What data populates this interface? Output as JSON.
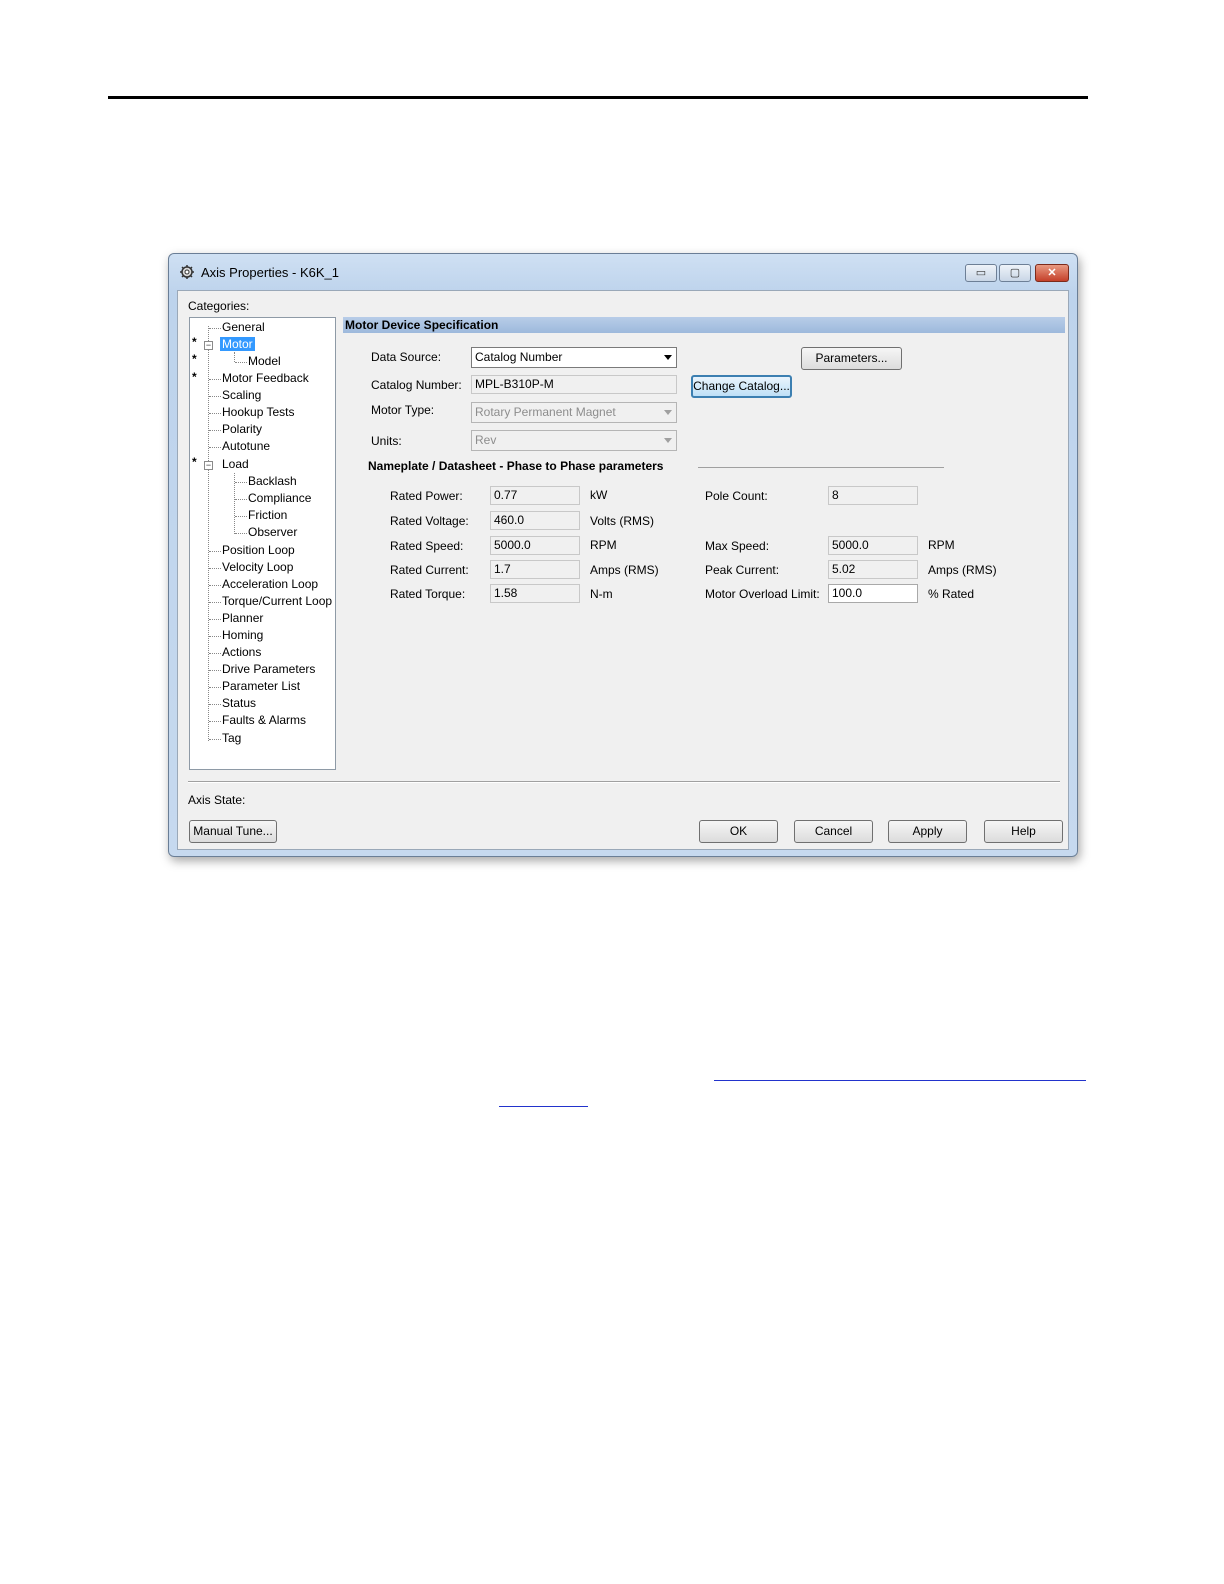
{
  "window": {
    "title": "Axis Properties - K6K_1",
    "controls": {
      "minimize": "▭",
      "maximize": "▢",
      "close": "✕"
    }
  },
  "categories": {
    "label": "Categories:",
    "items": [
      {
        "label": "General"
      },
      {
        "label": "Motor",
        "selected": true
      },
      {
        "label": "Model"
      },
      {
        "label": "Motor Feedback"
      },
      {
        "label": "Scaling"
      },
      {
        "label": "Hookup Tests"
      },
      {
        "label": "Polarity"
      },
      {
        "label": "Autotune"
      },
      {
        "label": "Load"
      },
      {
        "label": "Backlash"
      },
      {
        "label": "Compliance"
      },
      {
        "label": "Friction"
      },
      {
        "label": "Observer"
      },
      {
        "label": "Position Loop"
      },
      {
        "label": "Velocity Loop"
      },
      {
        "label": "Acceleration Loop"
      },
      {
        "label": "Torque/Current Loop"
      },
      {
        "label": "Planner"
      },
      {
        "label": "Homing"
      },
      {
        "label": "Actions"
      },
      {
        "label": "Drive Parameters"
      },
      {
        "label": "Parameter List"
      },
      {
        "label": "Status"
      },
      {
        "label": "Faults & Alarms"
      },
      {
        "label": "Tag"
      }
    ],
    "markers": {
      "star": "*",
      "collapse": "−"
    }
  },
  "panel": {
    "header": "Motor Device Specification",
    "data_source": {
      "label": "Data Source:",
      "value": "Catalog Number"
    },
    "parameters_button": "Parameters...",
    "catalog_number": {
      "label": "Catalog Number:",
      "value": "MPL-B310P-M"
    },
    "change_catalog_button": "Change Catalog...",
    "motor_type": {
      "label": "Motor Type:",
      "value": "Rotary Permanent Magnet"
    },
    "units": {
      "label": "Units:",
      "value": "Rev"
    },
    "nameplate": {
      "title": "Nameplate / Datasheet - Phase to Phase parameters",
      "rated_power": {
        "label": "Rated Power:",
        "value": "0.77",
        "unit": "kW"
      },
      "rated_voltage": {
        "label": "Rated Voltage:",
        "value": "460.0",
        "unit": "Volts (RMS)"
      },
      "rated_speed": {
        "label": "Rated Speed:",
        "value": "5000.0",
        "unit": "RPM"
      },
      "rated_current": {
        "label": "Rated Current:",
        "value": "1.7",
        "unit": "Amps (RMS)"
      },
      "rated_torque": {
        "label": "Rated Torque:",
        "value": "1.58",
        "unit": "N-m"
      },
      "pole_count": {
        "label": "Pole Count:",
        "value": "8"
      },
      "max_speed": {
        "label": "Max Speed:",
        "value": "5000.0",
        "unit": "RPM"
      },
      "peak_current": {
        "label": "Peak Current:",
        "value": "5.02",
        "unit": "Amps (RMS)"
      },
      "overload_limit": {
        "label": "Motor Overload Limit:",
        "value": "100.0",
        "unit": "% Rated"
      }
    }
  },
  "footer": {
    "axis_state_label": "Axis State:",
    "manual_tune": "Manual Tune...",
    "ok": "OK",
    "cancel": "Cancel",
    "apply": "Apply",
    "help": "Help"
  }
}
